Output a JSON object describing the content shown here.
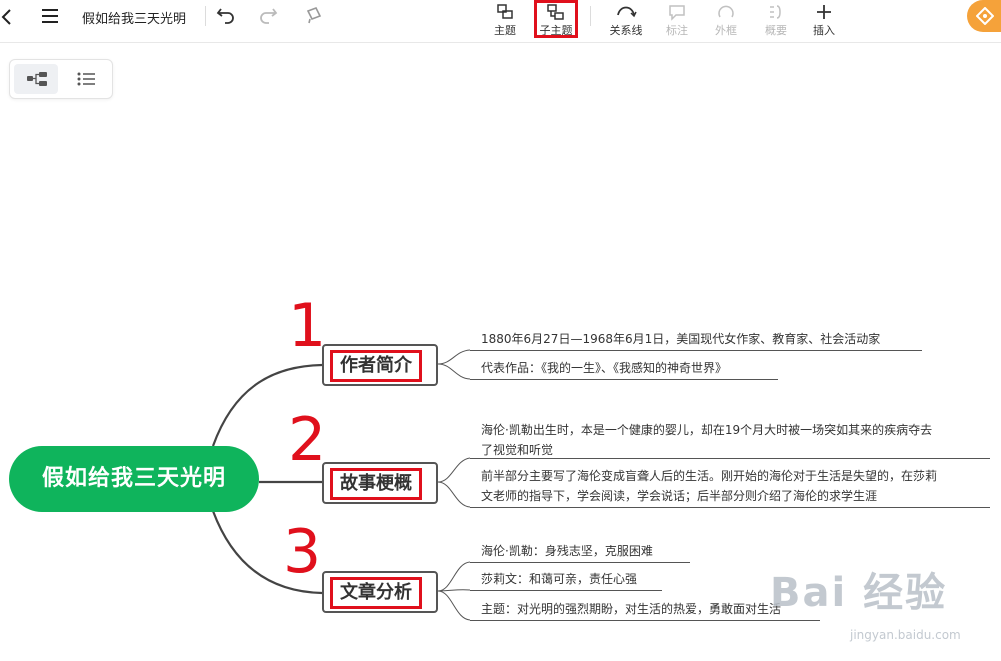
{
  "toolbar": {
    "doc_title": "假如给我三天光明",
    "tools": [
      {
        "id": "topic",
        "label": "主题",
        "enabled": true
      },
      {
        "id": "subtopic",
        "label": "子主题",
        "enabled": true,
        "highlighted": true
      },
      {
        "id": "relation",
        "label": "关系线",
        "enabled": true
      },
      {
        "id": "note",
        "label": "标注",
        "enabled": false
      },
      {
        "id": "boundary",
        "label": "外框",
        "enabled": false
      },
      {
        "id": "summary",
        "label": "概要",
        "enabled": false
      },
      {
        "id": "insert",
        "label": "插入",
        "enabled": true
      }
    ]
  },
  "mindmap": {
    "root": "假如给我三天光明",
    "branches": [
      {
        "number": "1",
        "label": "作者简介",
        "leaves": [
          "1880年6月27日—1968年6月1日，美国现代女作家、教育家、社会活动家",
          "代表作品：《我的一生》、《我感知的神奇世界》"
        ]
      },
      {
        "number": "2",
        "label": "故事梗概",
        "leaves": [
          "海伦·凯勒出生时，本是一个健康的婴儿，却在19个月大时被一场突如其来的疾病夺去了视觉和听觉",
          "前半部分主要写了海伦变成盲聋人后的生活。刚开始的海伦对于生活是失望的，在莎莉文老师的指导下，学会阅读，学会说话；后半部分则介绍了海伦的求学生涯"
        ],
        "leaf_lines": [
          [
            "海伦·凯勒出生时，本是一个健康的婴儿，却在19个月大时被一场突如其来的疾病夺去",
            "了视觉和听觉"
          ],
          [
            "前半部分主要写了海伦变成盲聋人后的生活。刚开始的海伦对于生活是失望的，在莎莉",
            "文老师的指导下，学会阅读，学会说话；后半部分则介绍了海伦的求学生涯"
          ]
        ]
      },
      {
        "number": "3",
        "label": "文章分析",
        "leaves": [
          "海伦·凯勒：身残志坚，克服困难",
          "莎莉文：和蔼可亲，责任心强",
          "主题：对光明的强烈期盼，对生活的热爱，勇敢面对生活"
        ]
      }
    ]
  },
  "watermark": {
    "text": "Bai 经验",
    "sub": "jingyan.baidu.com"
  },
  "colors": {
    "root": "#0fb45c",
    "highlight": "#e0101c",
    "line": "#555555"
  }
}
